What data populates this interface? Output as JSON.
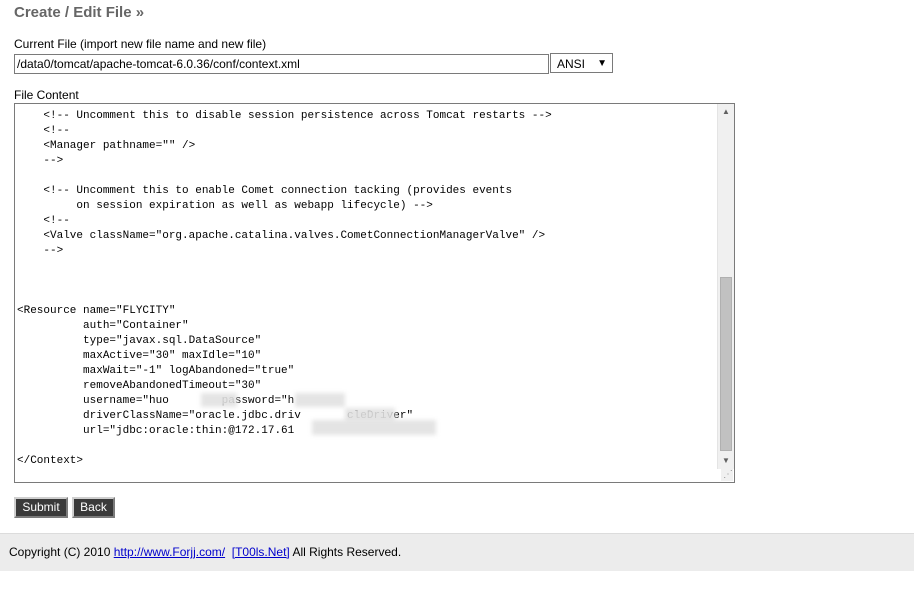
{
  "page": {
    "title": "Create / Edit File »"
  },
  "current_file": {
    "label": "Current File (import new file name and new file)",
    "path_value": "/data0/tomcat/apache-tomcat-6.0.36/conf/context.xml",
    "encoding": "ANSI"
  },
  "file_content": {
    "label": "File Content",
    "text": "    <!-- Uncomment this to disable session persistence across Tomcat restarts -->\n    <!--\n    <Manager pathname=\"\" />\n    -->\n\n    <!-- Uncomment this to enable Comet connection tacking (provides events\n         on session expiration as well as webapp lifecycle) -->\n    <!--\n    <Valve className=\"org.apache.catalina.valves.CometConnectionManagerValve\" />\n    -->\n\n\n\n<Resource name=\"FLYCITY\"\n          auth=\"Container\"\n          type=\"javax.sql.DataSource\"\n          maxActive=\"30\" maxIdle=\"10\"\n          maxWait=\"-1\" logAbandoned=\"true\"\n          removeAbandonedTimeout=\"30\"\n          username=\"huo        password=\"h\n          driverClassName=\"oracle.jdbc.driv       cleDriver\"\n          url=\"jdbc:oracle:thin:@172.17.61\n\n</Context>"
  },
  "buttons": {
    "submit": "Submit",
    "back": "Back"
  },
  "footer": {
    "prefix": "Copyright (C) 2010 ",
    "link1": "http://www.Forjj.com/",
    "link2": "[T00ls.Net]",
    "suffix": " All Rights Reserved."
  }
}
